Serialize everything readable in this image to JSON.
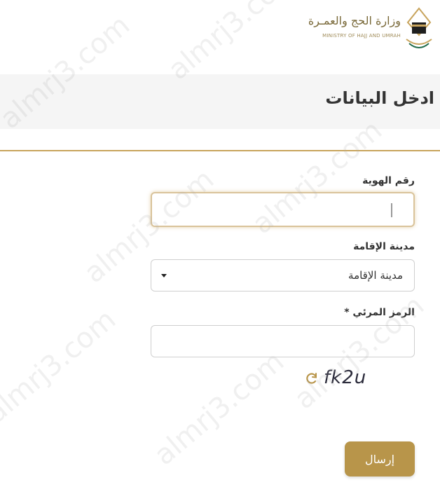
{
  "header": {
    "logo_ar": "وزارة الحج والعمـرة",
    "logo_en": "MINISTRY OF HAJJ AND UMRAH"
  },
  "form": {
    "title": "ادخل البيانات",
    "id_label": "رقم الهوية",
    "id_value": "",
    "city_label": "مدينة الإقامة",
    "city_selected": "مدينة الإقامة",
    "captcha_label": "الرمز المرئي *",
    "captcha_value": "",
    "captcha_code": "fk2u",
    "submit_label": "إرسال"
  },
  "watermark": "almrj3.com",
  "colors": {
    "accent": "#b8954a",
    "divider": "#c8a45c",
    "title_band": "#f5f5f5"
  }
}
